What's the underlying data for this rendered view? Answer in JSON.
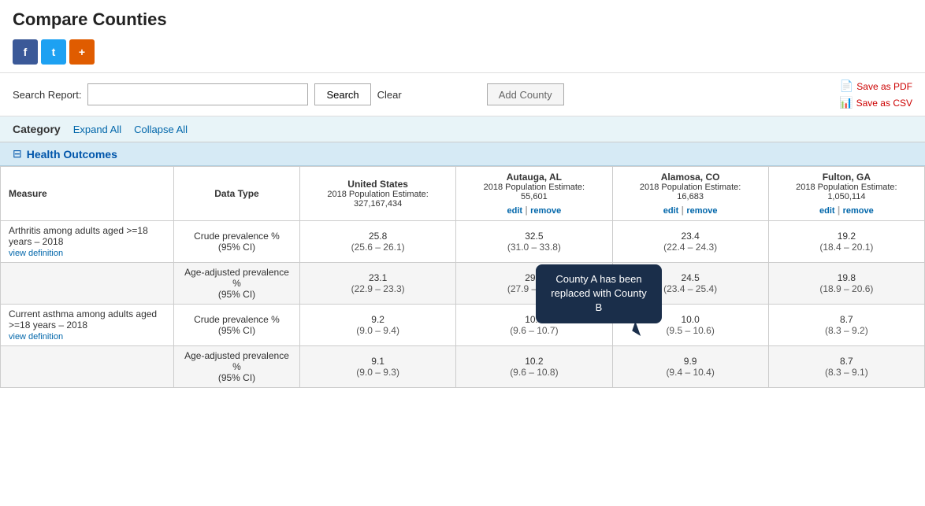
{
  "page": {
    "title": "Compare Counties"
  },
  "social": {
    "facebook_label": "f",
    "twitter_label": "t",
    "add_label": "+"
  },
  "toolbar": {
    "search_report_label": "Search Report:",
    "search_input_placeholder": "",
    "search_button": "Search",
    "clear_button": "Clear",
    "add_county_button": "Add County"
  },
  "exports": {
    "save_pdf": "Save as PDF",
    "save_csv": "Save as CSV"
  },
  "category_bar": {
    "label": "Category",
    "expand_all": "Expand All",
    "collapse_all": "Collapse All"
  },
  "tooltip": {
    "text": "County A has been replaced with County B"
  },
  "section": {
    "title": "Health Outcomes"
  },
  "table": {
    "headers": {
      "measure": "Measure",
      "data_type": "Data Type",
      "us": {
        "name": "United States",
        "pop_label": "2018 Population Estimate:",
        "pop_value": "327,167,434"
      },
      "autauga": {
        "name": "Autauga, AL",
        "pop_label": "2018 Population Estimate:",
        "pop_value": "55,601",
        "edit": "edit",
        "remove": "remove"
      },
      "alamosa": {
        "name": "Alamosa, CO",
        "pop_label": "2018 Population Estimate:",
        "pop_value": "16,683",
        "edit": "edit",
        "remove": "remove"
      },
      "fulton": {
        "name": "Fulton, GA",
        "pop_label": "2018 Population Estimate:",
        "pop_value": "1,050,114",
        "edit": "edit",
        "remove": "remove"
      }
    },
    "rows": [
      {
        "measure": "Arthritis among adults aged >=18 years – 2018",
        "view_def": "view definition",
        "data_type": "Crude prevalence %\n(95% CI)",
        "us": "25.8\n(25.6 – 26.1)",
        "autauga": "32.5\n(31.0 – 33.8)",
        "alamosa": "23.4\n(22.4 – 24.3)",
        "fulton": "19.2\n(18.4 – 20.1)"
      },
      {
        "measure": "",
        "view_def": "",
        "data_type": "Age-adjusted prevalence %\n(95% CI)",
        "us": "23.1\n(22.9 – 23.3)",
        "autauga": "29.3\n(27.9 – 30.5)",
        "alamosa": "24.5\n(23.4 – 25.4)",
        "fulton": "19.8\n(18.9 – 20.6)"
      },
      {
        "measure": "Current asthma among adults aged >=18 years – 2018",
        "view_def": "view definition",
        "data_type": "Crude prevalence %\n(95% CI)",
        "us": "9.2\n(9.0 – 9.4)",
        "autauga": "10.2\n(9.6 – 10.7)",
        "alamosa": "10.0\n(9.5 – 10.6)",
        "fulton": "8.7\n(8.3 – 9.2)"
      },
      {
        "measure": "",
        "view_def": "",
        "data_type": "Age-adjusted prevalence %\n(95% CI)",
        "us": "9.1\n(9.0 – 9.3)",
        "autauga": "10.2\n(9.6 – 10.8)",
        "alamosa": "9.9\n(9.4 – 10.4)",
        "fulton": "8.7\n(8.3 – 9.1)"
      }
    ]
  }
}
